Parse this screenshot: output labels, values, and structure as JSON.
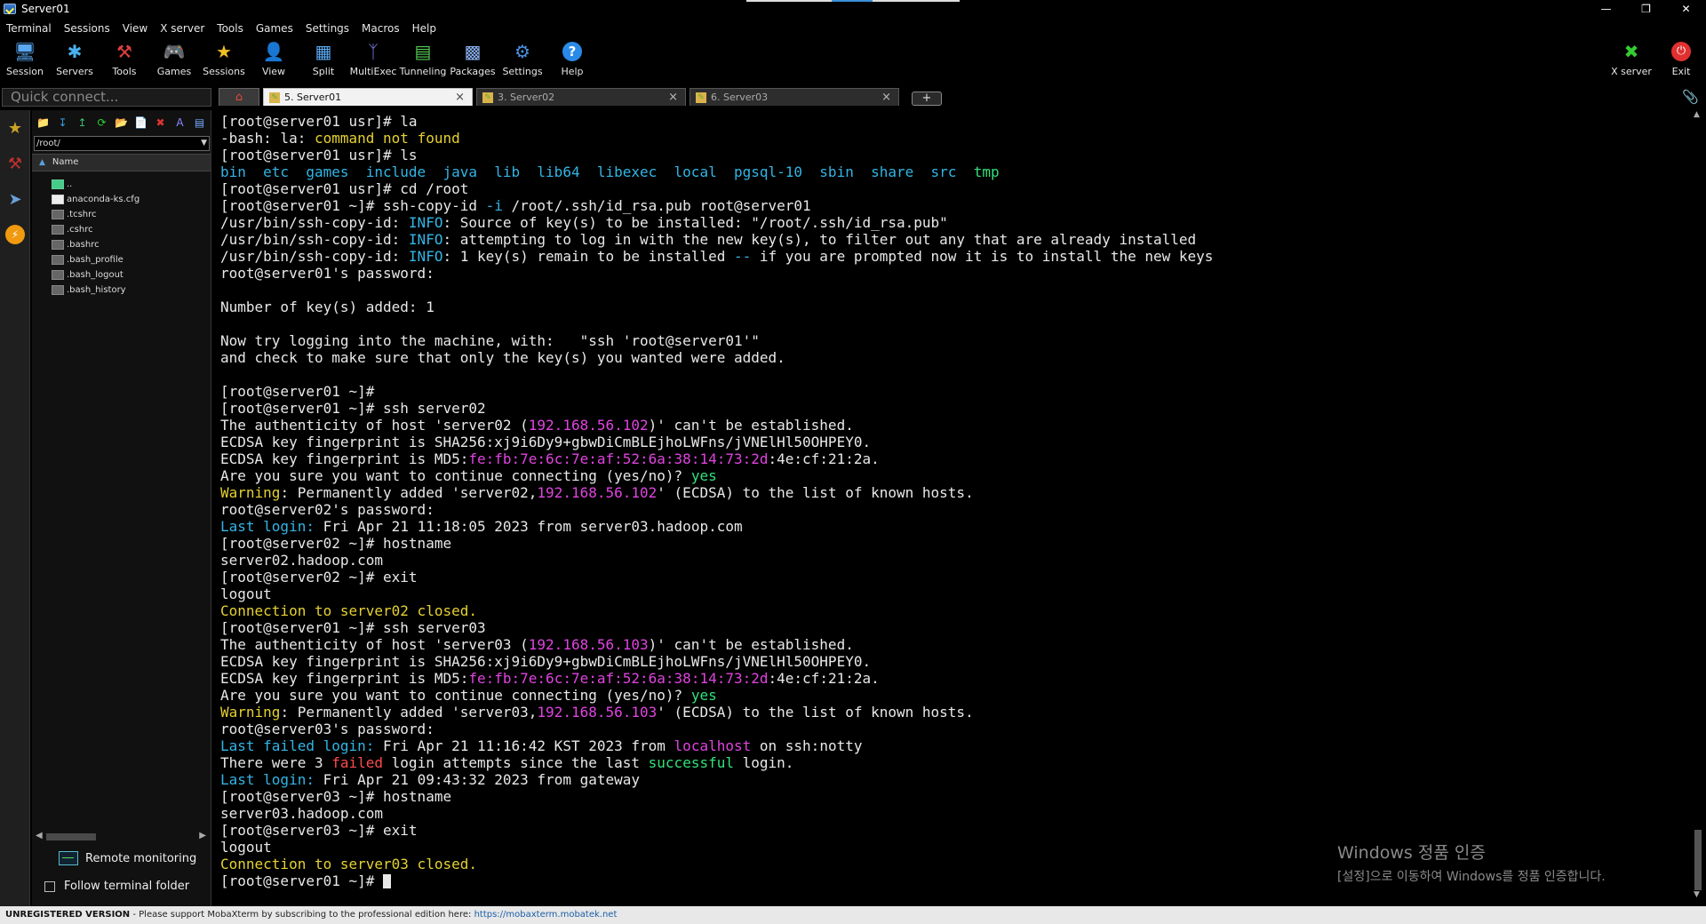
{
  "window": {
    "title": "Server01"
  },
  "menu": [
    "Terminal",
    "Sessions",
    "View",
    "X server",
    "Tools",
    "Games",
    "Settings",
    "Macros",
    "Help"
  ],
  "toolbar": {
    "left": [
      {
        "label": "Session",
        "icon": "session-icon"
      },
      {
        "label": "Servers",
        "icon": "servers-icon"
      },
      {
        "label": "Tools",
        "icon": "tools-icon"
      },
      {
        "label": "Games",
        "icon": "games-icon"
      },
      {
        "label": "Sessions",
        "icon": "sessions-star-icon"
      },
      {
        "label": "View",
        "icon": "view-icon"
      },
      {
        "label": "Split",
        "icon": "split-icon"
      },
      {
        "label": "MultiExec",
        "icon": "multiexec-icon"
      },
      {
        "label": "Tunneling",
        "icon": "tunneling-icon"
      },
      {
        "label": "Packages",
        "icon": "packages-icon"
      },
      {
        "label": "Settings",
        "icon": "settings-icon"
      },
      {
        "label": "Help",
        "icon": "help-icon"
      }
    ],
    "right": [
      {
        "label": "X server",
        "icon": "xserver-icon"
      },
      {
        "label": "Exit",
        "icon": "exit-icon"
      }
    ]
  },
  "quick_connect": {
    "placeholder": "Quick connect..."
  },
  "tabs": [
    {
      "label": "5. Server01",
      "active": true
    },
    {
      "label": "3. Server02",
      "active": false
    },
    {
      "label": "6. Server03",
      "active": false
    }
  ],
  "sidebar": {
    "path": "/root/",
    "column_header": "Name",
    "files": [
      "..",
      "anaconda-ks.cfg",
      ".tcshrc",
      ".cshrc",
      ".bashrc",
      ".bash_profile",
      ".bash_logout",
      ".bash_history"
    ],
    "remote_monitoring": "Remote monitoring",
    "follow_terminal": "Follow terminal folder"
  },
  "terminal": {
    "lines": [
      [
        {
          "t": "[root@server01 usr]# la"
        }
      ],
      [
        {
          "t": "-bash: la: "
        },
        {
          "t": "command not found",
          "c": "y"
        }
      ],
      [
        {
          "t": "[root@server01 usr]# ls"
        }
      ],
      [
        {
          "t": "bin  etc  games  include  java  lib  lib64  libexec  local  pgsql-10  sbin  share  src  ",
          "c": "b"
        },
        {
          "t": "tmp",
          "c": "g"
        }
      ],
      [
        {
          "t": "[root@server01 usr]# cd /root"
        }
      ],
      [
        {
          "t": "[root@server01 ~]# ssh-copy-id "
        },
        {
          "t": "-i",
          "c": "b"
        },
        {
          "t": " /root/.ssh/id_rsa.pub root@server01"
        }
      ],
      [
        {
          "t": "/usr/bin/ssh-copy-id: "
        },
        {
          "t": "INFO",
          "c": "b"
        },
        {
          "t": ": Source of key(s) to be installed: \"/root/.ssh/id_rsa.pub\""
        }
      ],
      [
        {
          "t": "/usr/bin/ssh-copy-id: "
        },
        {
          "t": "INFO",
          "c": "b"
        },
        {
          "t": ": attempting to log in with the new key(s), to filter out any that are already installed"
        }
      ],
      [
        {
          "t": "/usr/bin/ssh-copy-id: "
        },
        {
          "t": "INFO",
          "c": "b"
        },
        {
          "t": ": 1 key(s) remain to be installed "
        },
        {
          "t": "--",
          "c": "b"
        },
        {
          "t": " if you are prompted now it is to install the new keys"
        }
      ],
      [
        {
          "t": "root@server01's password:"
        }
      ],
      [
        {
          "t": ""
        }
      ],
      [
        {
          "t": "Number of key(s) added: 1"
        }
      ],
      [
        {
          "t": ""
        }
      ],
      [
        {
          "t": "Now try logging into the machine, with:   \"ssh 'root@server01'\""
        }
      ],
      [
        {
          "t": "and check to make sure that only the key(s) you wanted were added."
        }
      ],
      [
        {
          "t": ""
        }
      ],
      [
        {
          "t": "[root@server01 ~]#"
        }
      ],
      [
        {
          "t": "[root@server01 ~]# ssh server02"
        }
      ],
      [
        {
          "t": "The authenticity of host 'server02 ("
        },
        {
          "t": "192.168.56.102",
          "c": "m"
        },
        {
          "t": ")' can't be established."
        }
      ],
      [
        {
          "t": "ECDSA key fingerprint is SHA256:xj9i6Dy9+gbwDiCmBLEjhoLWFns/jVNElHl50OHPEY0."
        }
      ],
      [
        {
          "t": "ECDSA key fingerprint is MD5:"
        },
        {
          "t": "fe:fb:7e:6c:7e:af:52:6a:38:14:73:2d",
          "c": "m"
        },
        {
          "t": ":4e:cf:21:2a."
        }
      ],
      [
        {
          "t": "Are you sure you want to continue connecting (yes/no)? "
        },
        {
          "t": "yes",
          "c": "g"
        }
      ],
      [
        {
          "t": "Warning",
          "c": "y"
        },
        {
          "t": ": Permanently added 'server02,"
        },
        {
          "t": "192.168.56.102",
          "c": "m"
        },
        {
          "t": "' (ECDSA) to the list of known hosts."
        }
      ],
      [
        {
          "t": "root@server02's password:"
        }
      ],
      [
        {
          "t": "Last login:",
          "c": "b"
        },
        {
          "t": " Fri Apr 21 11:18:05 2023 from server03.hadoop.com"
        }
      ],
      [
        {
          "t": "[root@server02 ~]# hostname"
        }
      ],
      [
        {
          "t": "server02.hadoop.com"
        }
      ],
      [
        {
          "t": "[root@server02 ~]# exit"
        }
      ],
      [
        {
          "t": "logout"
        }
      ],
      [
        {
          "t": "Connection to server02 closed.",
          "c": "y"
        }
      ],
      [
        {
          "t": "[root@server01 ~]# ssh server03"
        }
      ],
      [
        {
          "t": "The authenticity of host 'server03 ("
        },
        {
          "t": "192.168.56.103",
          "c": "m"
        },
        {
          "t": ")' can't be established."
        }
      ],
      [
        {
          "t": "ECDSA key fingerprint is SHA256:xj9i6Dy9+gbwDiCmBLEjhoLWFns/jVNElHl50OHPEY0."
        }
      ],
      [
        {
          "t": "ECDSA key fingerprint is MD5:"
        },
        {
          "t": "fe:fb:7e:6c:7e:af:52:6a:38:14:73:2d",
          "c": "m"
        },
        {
          "t": ":4e:cf:21:2a."
        }
      ],
      [
        {
          "t": "Are you sure you want to continue connecting (yes/no)? "
        },
        {
          "t": "yes",
          "c": "g"
        }
      ],
      [
        {
          "t": "Warning",
          "c": "y"
        },
        {
          "t": ": Permanently added 'server03,"
        },
        {
          "t": "192.168.56.103",
          "c": "m"
        },
        {
          "t": "' (ECDSA) to the list of known hosts."
        }
      ],
      [
        {
          "t": "root@server03's password:"
        }
      ],
      [
        {
          "t": "Last failed login:",
          "c": "b"
        },
        {
          "t": " Fri Apr 21 11:16:42 KST 2023 from "
        },
        {
          "t": "localhost",
          "c": "m"
        },
        {
          "t": " on ssh:notty"
        }
      ],
      [
        {
          "t": "There were 3 "
        },
        {
          "t": "failed",
          "c": "r"
        },
        {
          "t": " login attempts since the last "
        },
        {
          "t": "successful",
          "c": "g"
        },
        {
          "t": " login."
        }
      ],
      [
        {
          "t": "Last login:",
          "c": "b"
        },
        {
          "t": " Fri Apr 21 09:43:32 2023 from gateway"
        }
      ],
      [
        {
          "t": "[root@server03 ~]# hostname"
        }
      ],
      [
        {
          "t": "server03.hadoop.com"
        }
      ],
      [
        {
          "t": "[root@server03 ~]# exit"
        }
      ],
      [
        {
          "t": "logout"
        }
      ],
      [
        {
          "t": "Connection to server03 closed.",
          "c": "y"
        }
      ],
      [
        {
          "t": "[root@server01 ~]# "
        }
      ]
    ]
  },
  "watermark": {
    "line1": "Windows 정품 인증",
    "line2": "[설정]으로 이동하여 Windows를 정품 인증합니다."
  },
  "statusbar": {
    "bold": "UNREGISTERED VERSION",
    "text": "  -  Please support MobaXterm by subscribing to the professional edition here:  ",
    "link": "https://mobaxterm.mobatek.net"
  }
}
